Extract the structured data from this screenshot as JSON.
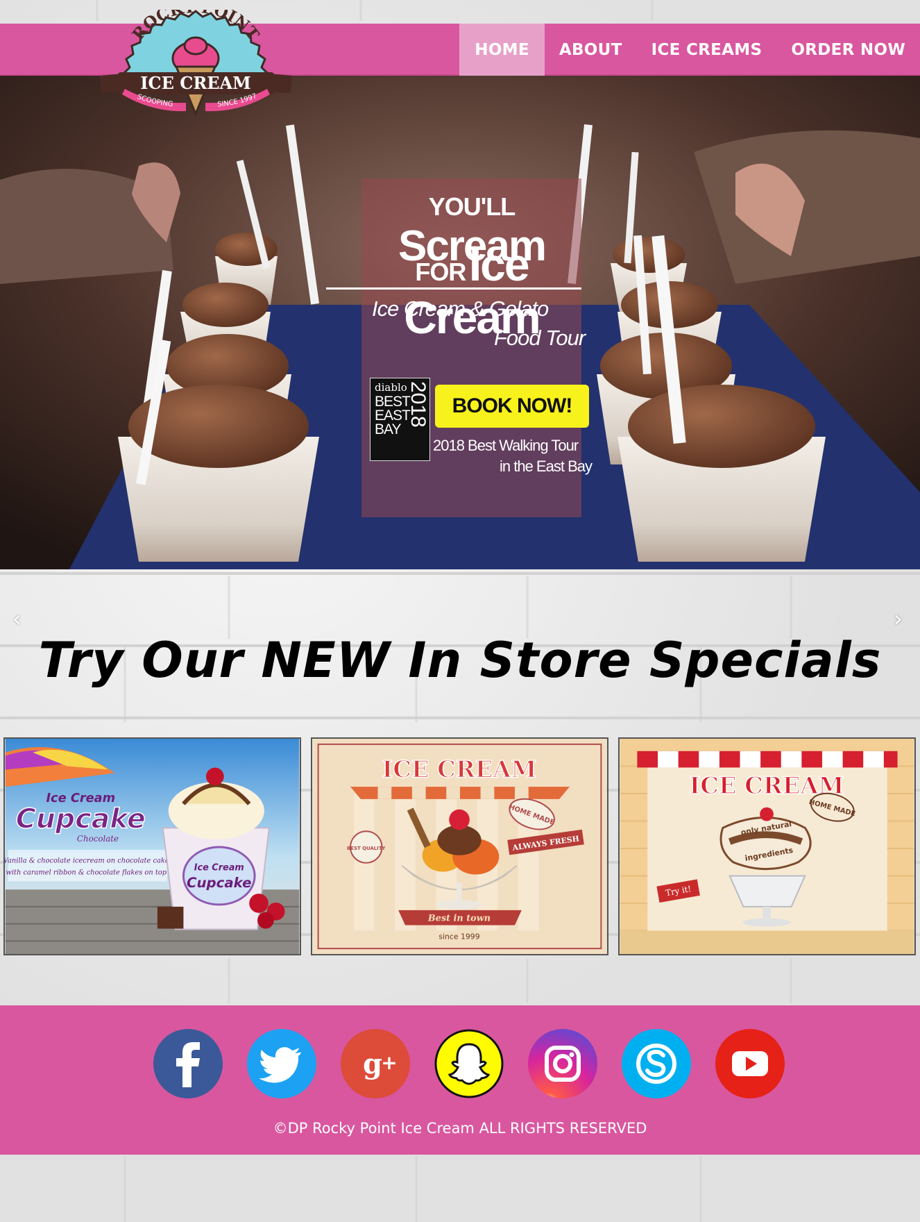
{
  "brand": {
    "top_arc": "ROCKY POINT",
    "banner": "ICE CREAM",
    "left_ribbon": "SCOOPING",
    "right_ribbon": "SINCE 1997"
  },
  "nav": {
    "items": [
      {
        "label": "HOME",
        "active": true
      },
      {
        "label": "ABOUT",
        "active": false
      },
      {
        "label": "ICE CREAMS",
        "active": false
      },
      {
        "label": "ORDER NOW",
        "active": false
      }
    ]
  },
  "hero": {
    "line1_small": "YOU'LL",
    "line1_big": "Scream",
    "line2_small": "FOR",
    "line2_big": "Ice Cream",
    "sub1": "Ice Cream & Gelato",
    "sub2": "Food Tour",
    "award": {
      "magazine": "diablo",
      "text": "BEST EAST BAY",
      "year": "2018"
    },
    "cta": "BOOK NOW!",
    "walk1": "2018 Best Walking Tour",
    "walk2": "in the East Bay"
  },
  "carousel": {
    "prev": "‹",
    "next": "›"
  },
  "specials": {
    "title": "Try Our NEW In Store Specials",
    "cards": [
      {
        "brand": "Ice Cream",
        "name": "Cupcake",
        "flavor": "Chocolate",
        "tagline_1": "Vanilla & chocolate icecream on chocolate cake",
        "tagline_2": "with caramel ribbon & chocolate flakes on top",
        "cup_label_1": "Ice Cream",
        "cup_label_2": "Cupcake"
      },
      {
        "headline": "ICE CREAM",
        "badge_1": "HOME MADE",
        "badge_2": "BEST QUALITY",
        "ribbon": "ALWAYS FRESH",
        "bottom_ribbon": "Best in town",
        "since": "since 1999"
      },
      {
        "headline": "ICE CREAM",
        "badge_1": "HOME MADE",
        "text_1": "only natural",
        "text_2": "ingredients",
        "tag": "Try it!"
      }
    ]
  },
  "footer": {
    "social": [
      {
        "name": "facebook",
        "color": "#3b5998"
      },
      {
        "name": "twitter",
        "color": "#1da1f2"
      },
      {
        "name": "google-plus",
        "color": "#dd4b39"
      },
      {
        "name": "snapchat",
        "color": "#fffc00"
      },
      {
        "name": "instagram",
        "color": "#c13584"
      },
      {
        "name": "skype",
        "color": "#00aff0"
      },
      {
        "name": "youtube",
        "color": "#e62117"
      }
    ],
    "copyright": "©DP Rocky Point Ice Cream ALL RIGHTS RESERVED"
  }
}
